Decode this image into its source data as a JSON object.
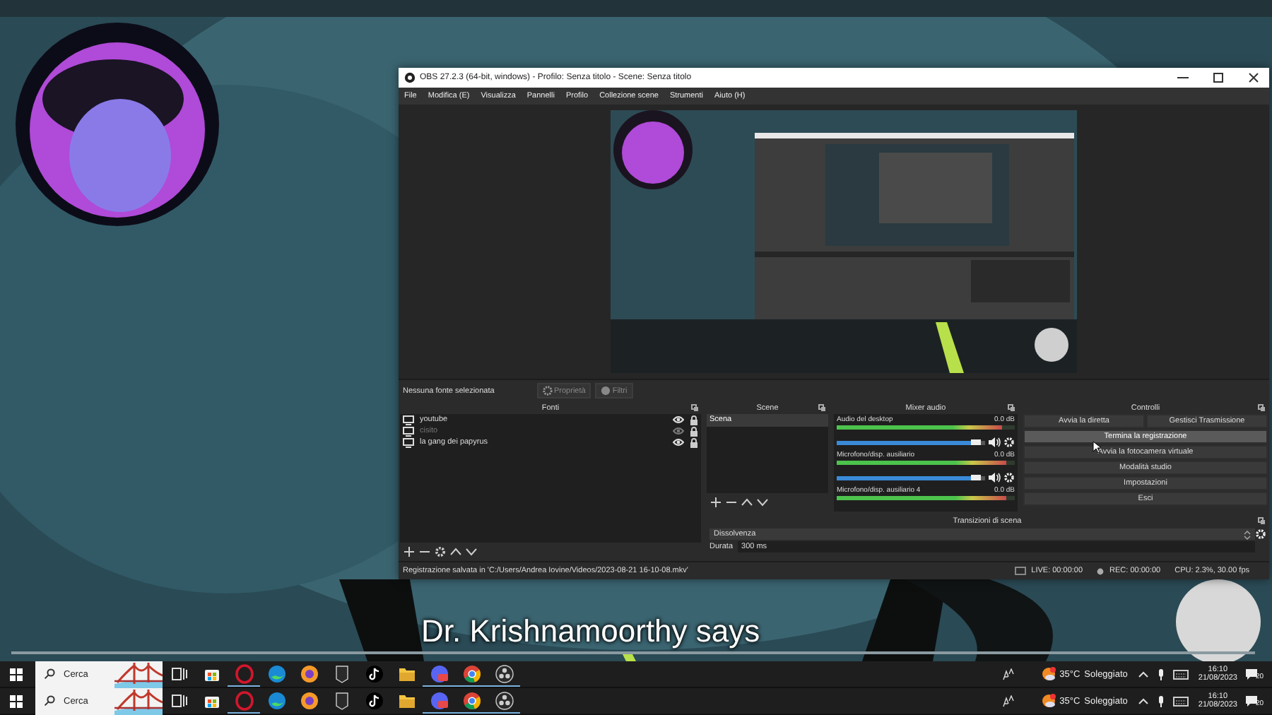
{
  "video": {
    "subtitle": "Dr. Krishnamoorthy says"
  },
  "obs_window": {
    "title": "OBS 27.2.3 (64-bit, windows) - Profilo: Senza titolo - Scene: Senza titolo",
    "menu": [
      "File",
      "Modifica (E)",
      "Visualizza",
      "Pannelli",
      "Profilo",
      "Collezione scene",
      "Strumenti",
      "Aiuto (H)"
    ],
    "source_toolbar": {
      "status": "Nessuna fonte selezionata",
      "buttons": [
        "Proprietà",
        "Filtri"
      ]
    },
    "sources": {
      "title": "Fonti",
      "items": [
        {
          "name": "youtube",
          "visible": true
        },
        {
          "name": "cisito",
          "visible": false
        },
        {
          "name": "la gang dei papyrus",
          "visible": true
        }
      ]
    },
    "scenes": {
      "title": "Scene",
      "items": [
        {
          "name": "Scena",
          "selected": true
        }
      ]
    },
    "mixer": {
      "title": "Mixer audio",
      "channels": [
        {
          "name": "Audio del desktop",
          "reading": "0.0 dB",
          "level": 0.93,
          "volume": {
            "level": 0.95
          }
        },
        {
          "name": "Microfono/disp. ausiliario",
          "reading": "0.0 dB",
          "level": 0.95,
          "volume": {
            "level": 0.95
          }
        },
        {
          "name": "Microfono/disp. ausiliario 4",
          "reading": "0.0 dB",
          "level": 0.95
        }
      ]
    },
    "controls": {
      "title": "Controlli",
      "rows": [
        [
          {
            "label": "Avvia la diretta",
            "hovered": false
          },
          {
            "label": "Gestisci Trasmissione",
            "hovered": false
          }
        ],
        [
          {
            "label": "Termina la registrazione",
            "hovered": true
          }
        ],
        [
          {
            "label": "Avvia la fotocamera virtuale",
            "hovered": false
          }
        ],
        [
          {
            "label": "Modalità studio",
            "hovered": false
          }
        ],
        [
          {
            "label": "Impostazioni",
            "hovered": false
          }
        ],
        [
          {
            "label": "Esci",
            "hovered": false
          }
        ]
      ]
    },
    "transitions": {
      "title": "Transizioni di scena",
      "transition": "Dissolvenza",
      "duration_label": "Durata",
      "duration": "300 ms"
    },
    "status_bar": {
      "message": "Registrazione salvata in 'C:/Users/Andrea Iovine/Videos/2023-08-21 16-10-08.mkv'",
      "live": "LIVE: 00:00:00",
      "rec": "REC: 00:00:00",
      "cpu": "CPU: 2.3%, 30.00 fps"
    }
  },
  "taskbars": [
    {
      "search": {
        "placeholder": "Cerca"
      },
      "apps": [
        {
          "kind": "taskview",
          "running": false
        },
        {
          "kind": "store",
          "running": false
        },
        {
          "kind": "opera",
          "running": true
        },
        {
          "kind": "edge",
          "running": false
        },
        {
          "kind": "firefox",
          "running": false
        },
        {
          "kind": "epic",
          "running": false
        },
        {
          "kind": "tiktok",
          "running": false
        },
        {
          "kind": "explorer",
          "running": false
        },
        {
          "kind": "discord",
          "running": true
        },
        {
          "kind": "chrome",
          "running": true
        },
        {
          "kind": "obs",
          "running": true
        }
      ],
      "weather": {
        "temperature": "35°C",
        "condition": "Soleggiato"
      },
      "time": "16:10",
      "date": "21/08/2023",
      "notifications": "20"
    },
    {
      "search": {
        "placeholder": "Cerca"
      },
      "apps": [
        {
          "kind": "taskview",
          "running": false
        },
        {
          "kind": "store",
          "running": false
        },
        {
          "kind": "opera",
          "running": true
        },
        {
          "kind": "edge",
          "running": false
        },
        {
          "kind": "firefox",
          "running": false
        },
        {
          "kind": "epic",
          "running": false
        },
        {
          "kind": "tiktok",
          "running": false
        },
        {
          "kind": "explorer",
          "running": false
        },
        {
          "kind": "discord",
          "running": true
        },
        {
          "kind": "chrome",
          "running": true
        },
        {
          "kind": "obs",
          "running": true
        }
      ],
      "weather": {
        "temperature": "35°C",
        "condition": "Soleggiato"
      },
      "time": "16:10",
      "date": "21/08/2023",
      "notifications": "20"
    }
  ]
}
